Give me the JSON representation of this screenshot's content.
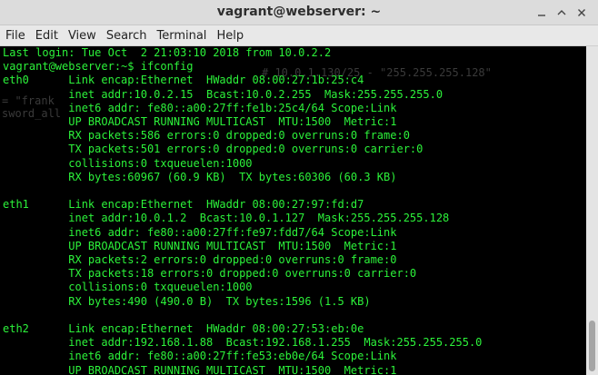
{
  "window": {
    "title": "vagrant@webserver: ~",
    "icons": {
      "minimize": "minimize-icon",
      "maximize": "maximize-icon",
      "close": "close-icon"
    }
  },
  "menu": [
    "File",
    "Edit",
    "View",
    "Search",
    "Terminal",
    "Help"
  ],
  "terminal": {
    "colors": {
      "background": "#000000",
      "text": "#2cf23a"
    },
    "ghost_text": [
      "# 10.0.1.130/25 - \"255.255.255.128\"",
      "= \"frank",
      "sword_all"
    ],
    "lines": [
      "Last login: Tue Oct  2 21:03:10 2018 from 10.0.2.2",
      "vagrant@webserver:~$ ifconfig",
      "eth0      Link encap:Ethernet  HWaddr 08:00:27:1b:25:c4",
      "          inet addr:10.0.2.15  Bcast:10.0.2.255  Mask:255.255.255.0",
      "          inet6 addr: fe80::a00:27ff:fe1b:25c4/64 Scope:Link",
      "          UP BROADCAST RUNNING MULTICAST  MTU:1500  Metric:1",
      "          RX packets:586 errors:0 dropped:0 overruns:0 frame:0",
      "          TX packets:501 errors:0 dropped:0 overruns:0 carrier:0",
      "          collisions:0 txqueuelen:1000",
      "          RX bytes:60967 (60.9 KB)  TX bytes:60306 (60.3 KB)",
      "",
      "eth1      Link encap:Ethernet  HWaddr 08:00:27:97:fd:d7",
      "          inet addr:10.0.1.2  Bcast:10.0.1.127  Mask:255.255.255.128",
      "          inet6 addr: fe80::a00:27ff:fe97:fdd7/64 Scope:Link",
      "          UP BROADCAST RUNNING MULTICAST  MTU:1500  Metric:1",
      "          RX packets:2 errors:0 dropped:0 overruns:0 frame:0",
      "          TX packets:18 errors:0 dropped:0 overruns:0 carrier:0",
      "          collisions:0 txqueuelen:1000",
      "          RX bytes:490 (490.0 B)  TX bytes:1596 (1.5 KB)",
      "",
      "eth2      Link encap:Ethernet  HWaddr 08:00:27:53:eb:0e",
      "          inet addr:192.168.1.88  Bcast:192.168.1.255  Mask:255.255.255.0",
      "          inet6 addr: fe80::a00:27ff:fe53:eb0e/64 Scope:Link",
      "          UP BROADCAST RUNNING MULTICAST  MTU:1500  Metric:1"
    ]
  }
}
